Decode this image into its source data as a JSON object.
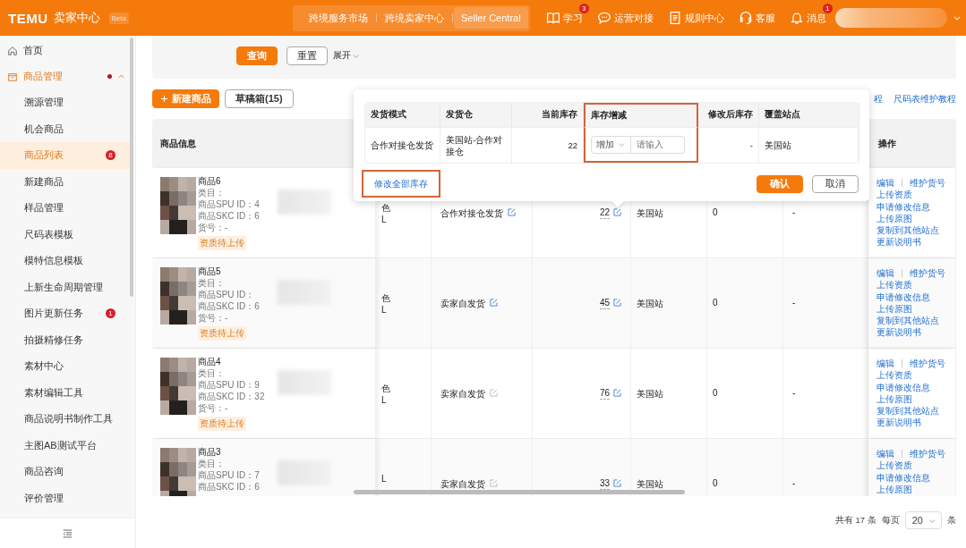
{
  "header": {
    "logo": "TEMU",
    "app_name": "卖家中心",
    "badge": "Beta",
    "nav_links": [
      {
        "label": "跨境服务市场",
        "selected": false
      },
      {
        "label": "跨境卖家中心",
        "selected": false
      },
      {
        "label": "Seller Central",
        "selected": true
      }
    ],
    "tools": [
      {
        "kind": "book",
        "label": "学习",
        "badge": "3"
      },
      {
        "kind": "chat",
        "label": "运营对接"
      },
      {
        "kind": "document",
        "label": "规则中心"
      },
      {
        "kind": "headset",
        "label": "客服"
      },
      {
        "kind": "bell",
        "label": "消息",
        "badge": "1"
      }
    ]
  },
  "sidebar": {
    "items": [
      {
        "kind": "home",
        "label": "首页",
        "selected": false
      },
      {
        "kind": "box",
        "label": "商品管理",
        "selected": false,
        "expanded": true,
        "dot": true,
        "children": [
          {
            "label": "溯源管理",
            "selected": false
          },
          {
            "label": "机会商品",
            "selected": false
          },
          {
            "label": "商品列表",
            "selected": true,
            "badge": "8"
          },
          {
            "label": "新建商品",
            "selected": false
          },
          {
            "label": "样品管理",
            "selected": false
          },
          {
            "label": "尺码表模板",
            "selected": false
          },
          {
            "label": "模特信息模板",
            "selected": false
          },
          {
            "label": "上新生命周期管理",
            "selected": false
          },
          {
            "label": "图片更新任务",
            "selected": false,
            "badge": "1"
          },
          {
            "label": "拍摄精修任务",
            "selected": false
          },
          {
            "label": "素材中心",
            "selected": false
          },
          {
            "label": "素材编辑工具",
            "selected": false
          },
          {
            "label": "商品说明书制作工具",
            "selected": false
          },
          {
            "label": "主图AB测试平台",
            "selected": false
          },
          {
            "label": "商品咨询",
            "selected": false
          },
          {
            "label": "评价管理",
            "selected": false
          }
        ]
      }
    ]
  },
  "filter": {
    "buttons": [
      {
        "kind": "primary",
        "label": "查询"
      },
      {
        "kind": "default",
        "label": "重置"
      }
    ],
    "expand_toggle": "展开"
  },
  "toolbar": {
    "create_button": "新建商品",
    "drafts_button": "草稿箱(15)",
    "links": [
      "程",
      "尺码表维护教程"
    ]
  },
  "table": {
    "header": {
      "product_info": "商品信息",
      "actions": "操作"
    },
    "rows": [
      {
        "name": "商品6",
        "info_lines": [
          "类目：",
          "商品SPU ID：4",
          "商品SKC ID：6",
          "货号：-"
        ],
        "tag": "资质待上传",
        "spec": [
          "色",
          "L"
        ],
        "shipping": "合作对接仓发货",
        "shipping_editable": true,
        "stock": "22",
        "site": "美国站",
        "column_5": "0",
        "column_6": "-",
        "actions": [
          [
            "编辑",
            "维护货号"
          ],
          [
            "上传资质"
          ],
          [
            "申请修改信息"
          ],
          [
            "上传原图"
          ],
          [
            "复制到其他站点"
          ],
          [
            "更新说明书"
          ]
        ]
      },
      {
        "name": "商品5",
        "info_lines": [
          "类目：",
          "商品SPU ID：",
          "商品SKC ID：6",
          "货号：-"
        ],
        "tag": "资质待上传",
        "spec": [
          "色",
          "L"
        ],
        "shipping": "卖家自发货",
        "shipping_editable": true,
        "stock": "45",
        "site": "美国站",
        "column_5": "0",
        "column_6": "-",
        "actions": [
          [
            "编辑",
            "维护货号"
          ],
          [
            "上传资质"
          ],
          [
            "申请修改信息"
          ],
          [
            "上传原图"
          ],
          [
            "复制到其他站点"
          ],
          [
            "更新说明书"
          ]
        ]
      },
      {
        "name": "商品4",
        "info_lines": [
          "类目：",
          "商品SPU ID：9",
          "商品SKC ID：32",
          "货号：-"
        ],
        "tag": "资质待上传",
        "spec": [
          "色",
          "L"
        ],
        "shipping": "卖家自发货",
        "shipping_editable": false,
        "stock": "76",
        "site": "美国站",
        "column_5": "0",
        "column_6": "-",
        "actions": [
          [
            "编辑",
            "维护货号"
          ],
          [
            "上传资质"
          ],
          [
            "申请修改信息"
          ],
          [
            "上传原图"
          ],
          [
            "复制到其他站点"
          ],
          [
            "更新说明书"
          ]
        ]
      },
      {
        "name": "商品3",
        "info_lines": [
          "类目：",
          "商品SPU ID：7",
          "商品SKC ID：6"
        ],
        "spec": [
          "L"
        ],
        "shipping": "卖家自发货",
        "shipping_editable": false,
        "stock": "33",
        "site": "美国站",
        "column_5": "0",
        "column_6": "-",
        "actions": [
          [
            "编辑",
            "维护货号"
          ],
          [
            "上传资质"
          ],
          [
            "申请修改信息"
          ],
          [
            "上传原图"
          ]
        ]
      }
    ]
  },
  "pagination": {
    "total": "共有 17 条",
    "per_page_label": "每页",
    "page_size": "20",
    "unit": "条"
  },
  "popover": {
    "columns": [
      "发货模式",
      "发货仓",
      "当前库存",
      "库存增减",
      "修改后库存",
      "覆盖站点"
    ],
    "row": {
      "mode": "合作对接仓发货",
      "warehouse": "美国站-合作对接仓",
      "current": "22",
      "adjust_type": "增加",
      "adjust_placeholder": "请输入",
      "after": "-",
      "site": "美国站"
    },
    "bulk_link": "修改全部库存",
    "confirm": "确认",
    "cancel": "取消"
  }
}
